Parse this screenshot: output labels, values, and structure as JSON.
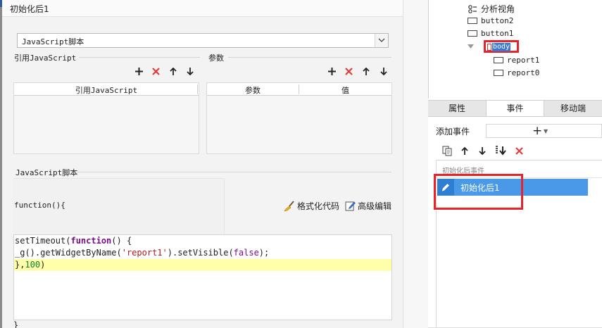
{
  "dialog": {
    "title": "初始化后1",
    "script_type": "JavaScript脚本",
    "ref_js_section": "引用JavaScript",
    "params_section": "参数",
    "ref_js_table": {
      "columns": [
        "引用JavaScript"
      ]
    },
    "params_table": {
      "columns": [
        "参数",
        "值"
      ]
    },
    "script_section": "JavaScript脚本",
    "function_header": "function(){",
    "format_code_label": "格式化代码",
    "advanced_edit_label": "高级编辑",
    "code": {
      "line1": [
        "setTimeout(",
        "function",
        "() {"
      ],
      "line2": [
        "_g().getWidgetByName(",
        "'report1'",
        ").setVisible(",
        "false",
        ");"
      ],
      "line3": [
        "},",
        "100",
        ")"
      ]
    },
    "closing_brace": "}"
  },
  "tree": {
    "items": [
      {
        "label": "分析视角",
        "icon": "view-icon"
      },
      {
        "label": "button2",
        "icon": "button-icon"
      },
      {
        "label": "button1",
        "icon": "button-icon"
      },
      {
        "label": "body",
        "icon": "body-icon",
        "selected": true
      },
      {
        "label": "report1",
        "icon": "report-icon"
      },
      {
        "label": "report0",
        "icon": "report-icon"
      }
    ]
  },
  "panel": {
    "tabs": [
      {
        "label": "属性",
        "active": false
      },
      {
        "label": "事件",
        "active": true
      },
      {
        "label": "移动端",
        "active": false
      }
    ],
    "add_event_label": "添加事件",
    "event_group": "初始化后事件",
    "event_item": "初始化后1"
  },
  "colors": {
    "selection_blue": "#4a98e8",
    "highlight_red": "#e8232b",
    "delete_red": "#e23b3b",
    "code_highlight": "#ffffaa"
  }
}
